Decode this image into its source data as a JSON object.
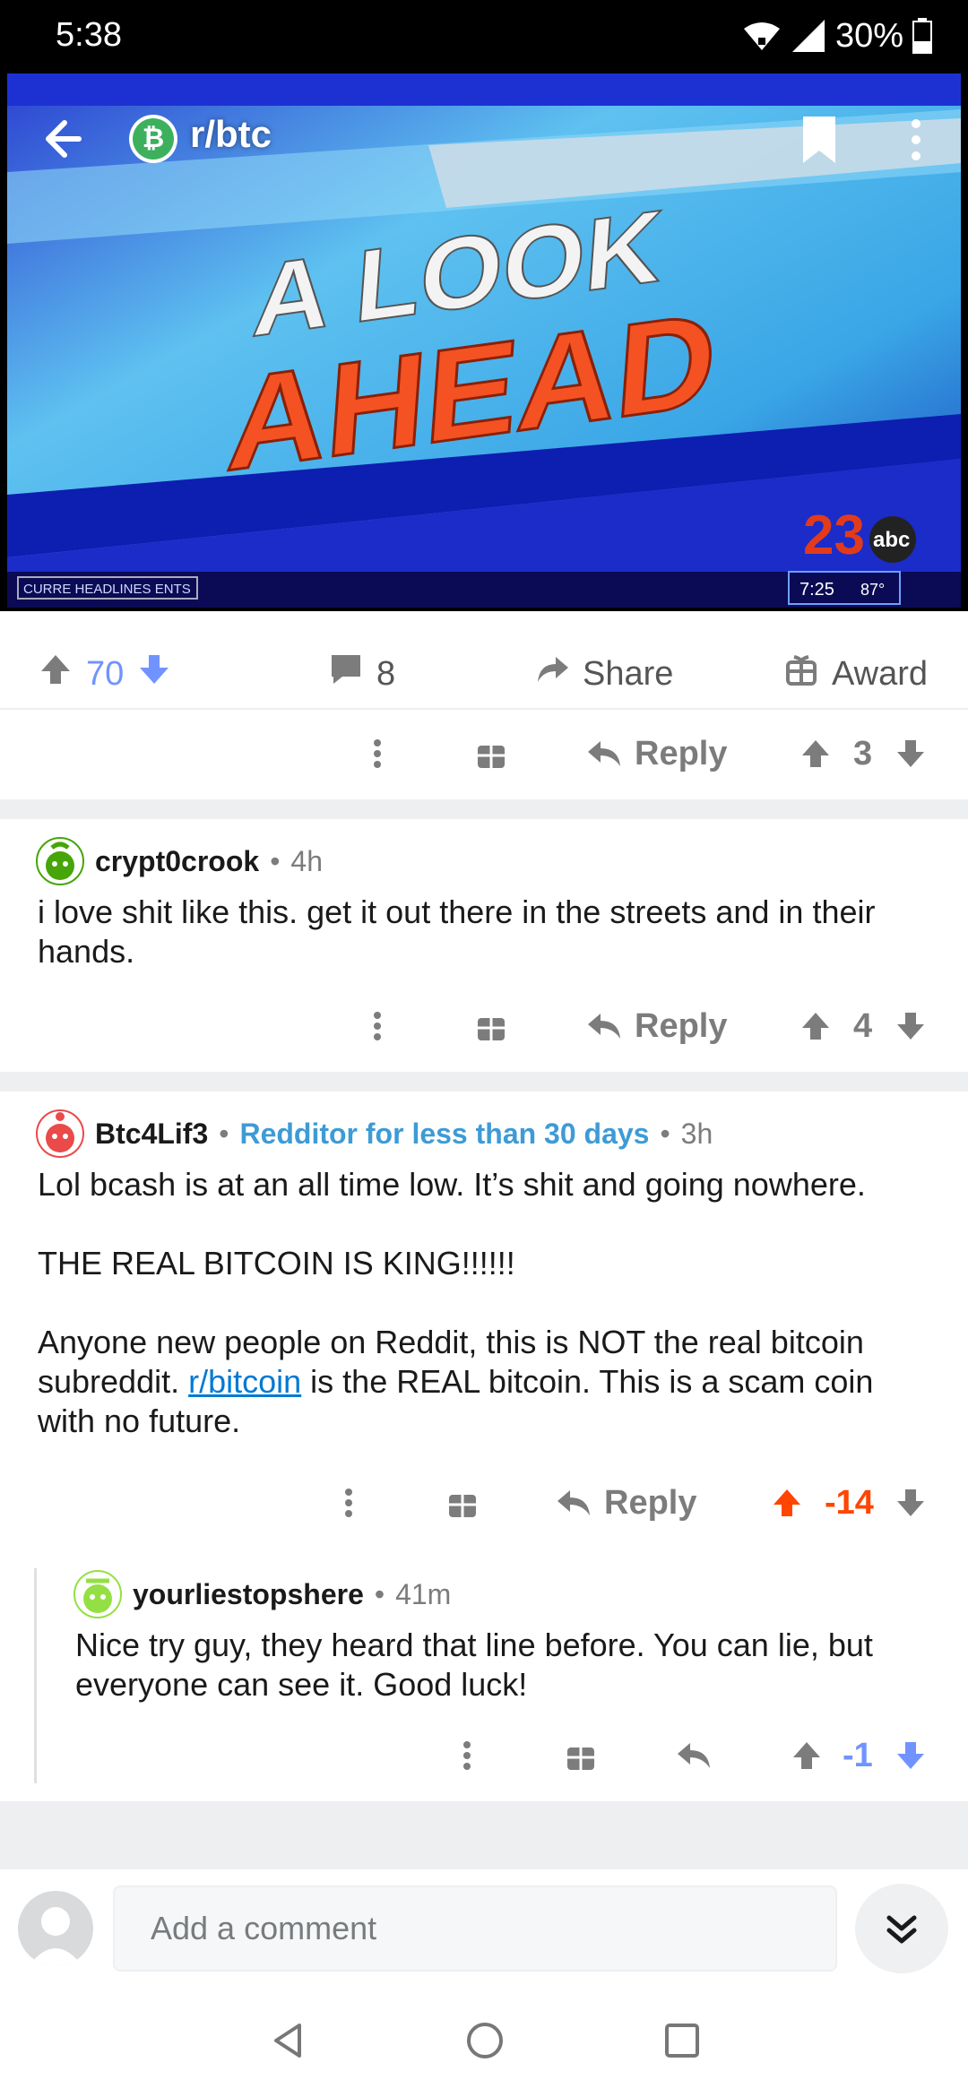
{
  "status_bar": {
    "time": "5:38",
    "battery": "30%"
  },
  "post": {
    "subreddit": "r/btc",
    "subreddit_icon": "bitcoin-cash-icon",
    "media": {
      "headline_top": "A LOOK",
      "headline_bottom": "AHEAD",
      "ticker": "CURRE HEADLINES ENTS",
      "channel": "23",
      "network": "abc",
      "time": "7:25",
      "temp": "87°"
    },
    "votes": "70",
    "comments": "8",
    "share_label": "Share",
    "award_label": "Award",
    "accent_color": "#7193ff"
  },
  "comment_rows": {
    "reply_label": "Reply"
  },
  "comments": [
    {
      "score": "3"
    },
    {
      "author": "crypt0crook",
      "age": "4h",
      "body": "i love shit like this. get it out there in the streets and in their hands.",
      "score": "4"
    },
    {
      "author": "Btc4Lif3",
      "flair": "Redditor for less than 30 days",
      "age": "3h",
      "body_p1": "Lol bcash is at an all time low. It’s shit and going nowhere.",
      "body_p2": "THE REAL BITCOIN IS KING!!!!!!",
      "body_p3_a": "Anyone new people on Reddit, this is NOT the real bitcoin subreddit. ",
      "body_p3_link": "r/bitcoin",
      "body_p3_b": " is the REAL bitcoin. This is a scam coin with no future.",
      "score": "-14",
      "score_color": "#ff4500"
    },
    {
      "author": "yourliestopshere",
      "age": "41m",
      "body": "Nice try guy, they heard that line before.  You can lie, but everyone can see it.  Good luck!",
      "score": "-1",
      "score_color": "#7193ff"
    }
  ],
  "input_bar": {
    "placeholder": "Add a comment"
  }
}
